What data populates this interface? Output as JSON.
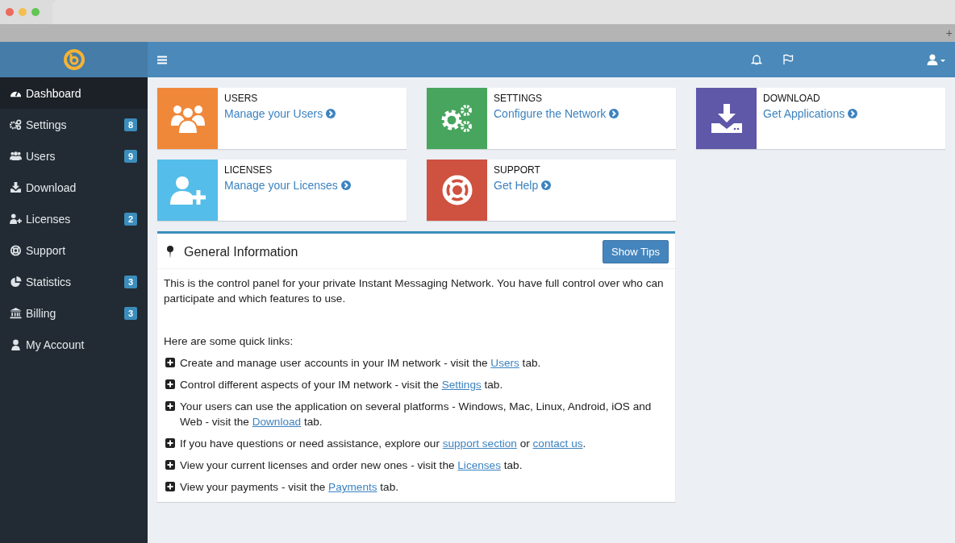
{
  "browser": {
    "new_tab": "+"
  },
  "sidebar": {
    "items": [
      {
        "label": "Dashboard",
        "selected": true
      },
      {
        "label": "Settings",
        "selected": false,
        "badge": "8"
      },
      {
        "label": "Users",
        "selected": false,
        "badge": "9"
      },
      {
        "label": "Download",
        "selected": false
      },
      {
        "label": "Licenses",
        "selected": false,
        "badge": "2"
      },
      {
        "label": "Support",
        "selected": false
      },
      {
        "label": "Statistics",
        "selected": false,
        "badge": "3"
      },
      {
        "label": "Billing",
        "selected": false,
        "badge": "3"
      },
      {
        "label": "My Account",
        "selected": false
      }
    ]
  },
  "tiles": [
    {
      "title": "USERS",
      "link": "Manage your Users",
      "color": "#f0883a"
    },
    {
      "title": "SETTINGS",
      "link": "Configure the Network",
      "color": "#47a55d"
    },
    {
      "title": "DOWNLOAD",
      "link": "Get Applications",
      "color": "#5f57a7"
    },
    {
      "title": "LICENSES",
      "link": "Manage your Licenses",
      "color": "#55bde9"
    },
    {
      "title": "SUPPORT",
      "link": "Get Help",
      "color": "#cf513f"
    }
  ],
  "panel": {
    "title": "General Information",
    "button": "Show Tips",
    "intro": "This is the control panel for your private Instant Messaging Network. You have full control over who can participate and which features to use.",
    "quick_links_heading": "Here are some quick links:",
    "quick_links": [
      [
        {
          "text": "Create and manage user accounts in your IM network - visit the "
        },
        {
          "link": "Users"
        },
        {
          "text": " tab."
        }
      ],
      [
        {
          "text": "Control different aspects of your IM network - visit the "
        },
        {
          "link": "Settings"
        },
        {
          "text": " tab."
        }
      ],
      [
        {
          "text": "Your users can use the application on several platforms - Windows, Mac, Linux, Android, iOS and Web - visit the "
        },
        {
          "link": "Download"
        },
        {
          "text": " tab."
        }
      ],
      [
        {
          "text": "If you have questions or need assistance, explore our "
        },
        {
          "link": "support section"
        },
        {
          "text": " or "
        },
        {
          "link": "contact us"
        },
        {
          "text": "."
        }
      ],
      [
        {
          "text": "View your current licenses and order new ones - visit the "
        },
        {
          "link": "Licenses"
        },
        {
          "text": " tab."
        }
      ],
      [
        {
          "text": "View your payments - visit the "
        },
        {
          "link": "Payments"
        },
        {
          "text": " tab."
        }
      ]
    ]
  }
}
